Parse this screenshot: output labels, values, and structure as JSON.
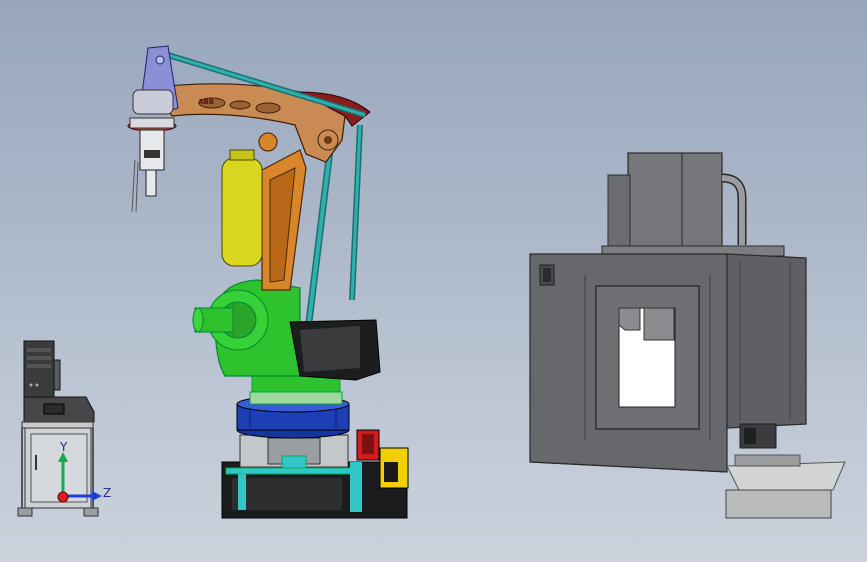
{
  "viewport": {
    "scene": "robot-workcell-assembly",
    "colors": {
      "robot_base_blue": "#1d3fb4",
      "robot_turret_green": "#2fc22f",
      "robot_arm_bronze": "#c98a54",
      "robot_upper_arm_orange": "#d9862a",
      "counterbalance_yellow": "#d8d61e",
      "rod_cyan": "#2fb0b0",
      "arm_tip_red": "#8b1c1c",
      "machine_gray": "#6b6d70",
      "machine_dark": "#3b3d40",
      "frame_cyan": "#33c6c6"
    }
  },
  "robot": {
    "logo_text": "ABB"
  },
  "triad": {
    "y_label": "Y",
    "z_label": "Z",
    "x_color": "#e01b1b",
    "y_color": "#1aa84d",
    "z_color": "#1b3fd6"
  }
}
